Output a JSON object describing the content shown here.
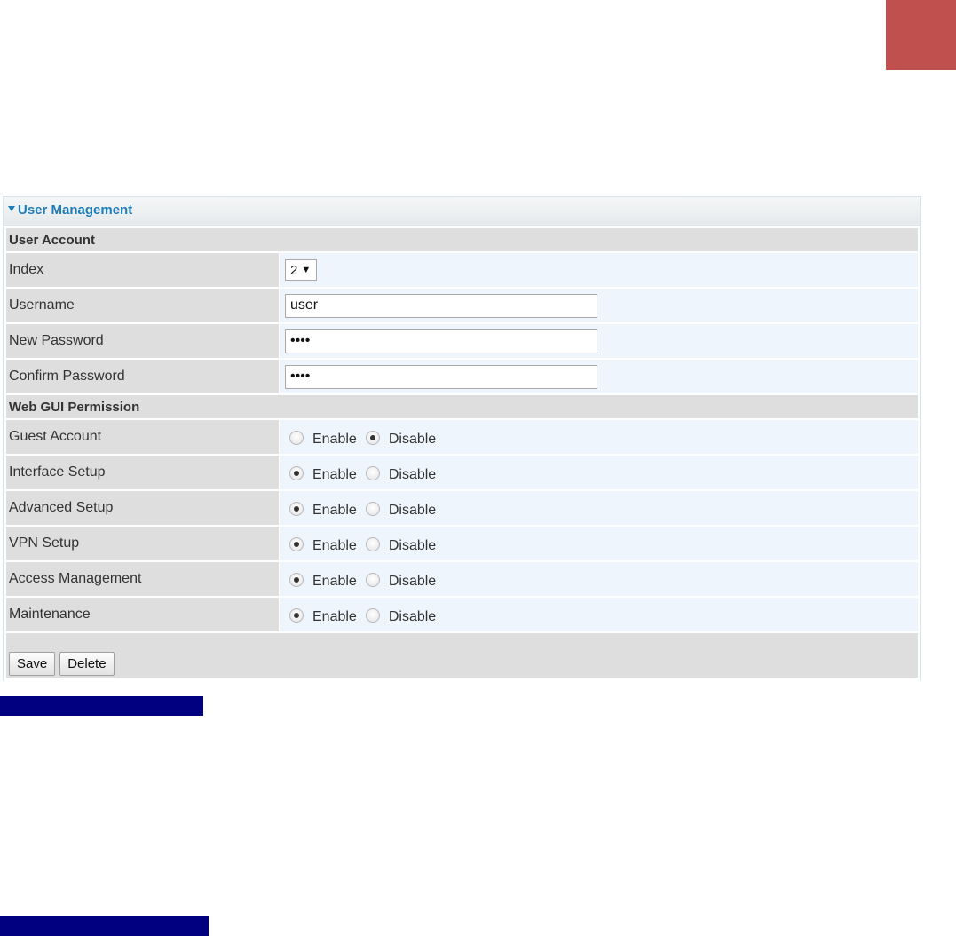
{
  "panel": {
    "title": "User Management"
  },
  "user_account": {
    "section_label": "User Account",
    "index": {
      "label": "Index",
      "value": "2"
    },
    "username": {
      "label": "Username",
      "value": "user"
    },
    "new_password": {
      "label": "New Password",
      "value": "••••"
    },
    "confirm_password": {
      "label": "Confirm Password",
      "value": "••••"
    }
  },
  "web_gui_permission": {
    "section_label": "Web GUI Permission",
    "enable_label": "Enable",
    "disable_label": "Disable",
    "rows": [
      {
        "label": "Guest Account",
        "selected": "disable"
      },
      {
        "label": "Interface Setup",
        "selected": "enable"
      },
      {
        "label": "Advanced Setup",
        "selected": "enable"
      },
      {
        "label": "VPN Setup",
        "selected": "enable"
      },
      {
        "label": "Access Management",
        "selected": "enable"
      },
      {
        "label": "Maintenance",
        "selected": "enable"
      }
    ]
  },
  "actions": {
    "save_label": "Save",
    "delete_label": "Delete"
  },
  "colors": {
    "accent": "#1c7cb8",
    "corner_block": "#c0504d",
    "caption_bar": "#000080"
  }
}
